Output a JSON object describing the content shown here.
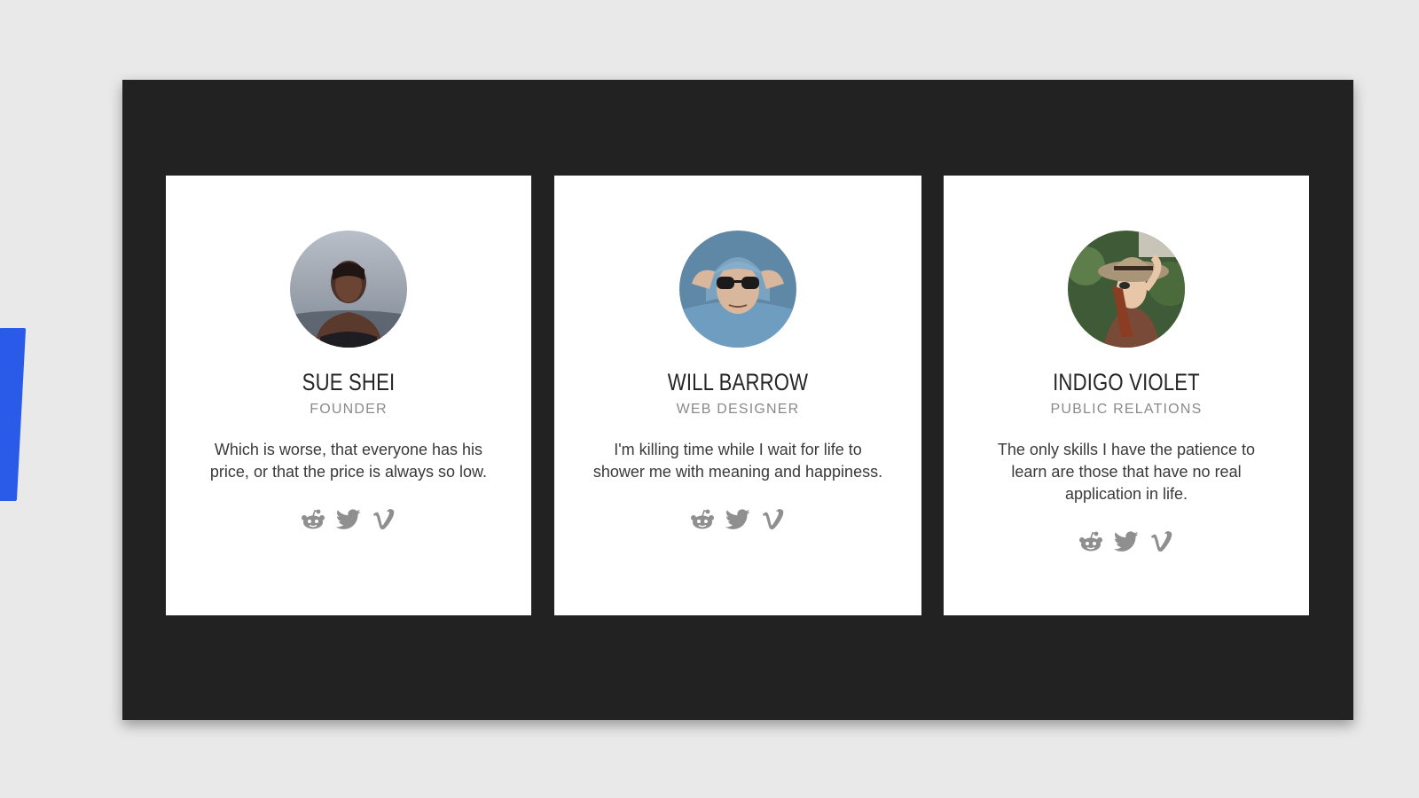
{
  "colors": {
    "page_background": "#e9e9e9",
    "panel_background": "#222222",
    "card_background": "#ffffff",
    "accent_blue": "#2a5be8",
    "name_text": "#262626",
    "role_text": "#8a8a8a",
    "icon_gray": "#8f8f8f"
  },
  "team": [
    {
      "name": "SUE SHEI",
      "role": "FOUNDER",
      "quote": "Which is worse, that everyone has his price, or that the price is always so low.",
      "avatar": "portrait-woman-by-water",
      "socials": [
        "reddit-icon",
        "twitter-icon",
        "vimeo-icon"
      ]
    },
    {
      "name": "WILL BARROW",
      "role": "WEB DESIGNER",
      "quote": "I'm killing time while I wait for life to shower me with meaning and happiness.",
      "avatar": "portrait-man-sunglasses-hood",
      "socials": [
        "reddit-icon",
        "twitter-icon",
        "vimeo-icon"
      ]
    },
    {
      "name": "INDIGO VIOLET",
      "role": "PUBLIC RELATIONS",
      "quote": "The only skills I have the patience to learn are those that have no real application in life.",
      "avatar": "portrait-woman-sun-hat",
      "socials": [
        "reddit-icon",
        "twitter-icon",
        "vimeo-icon"
      ]
    }
  ]
}
